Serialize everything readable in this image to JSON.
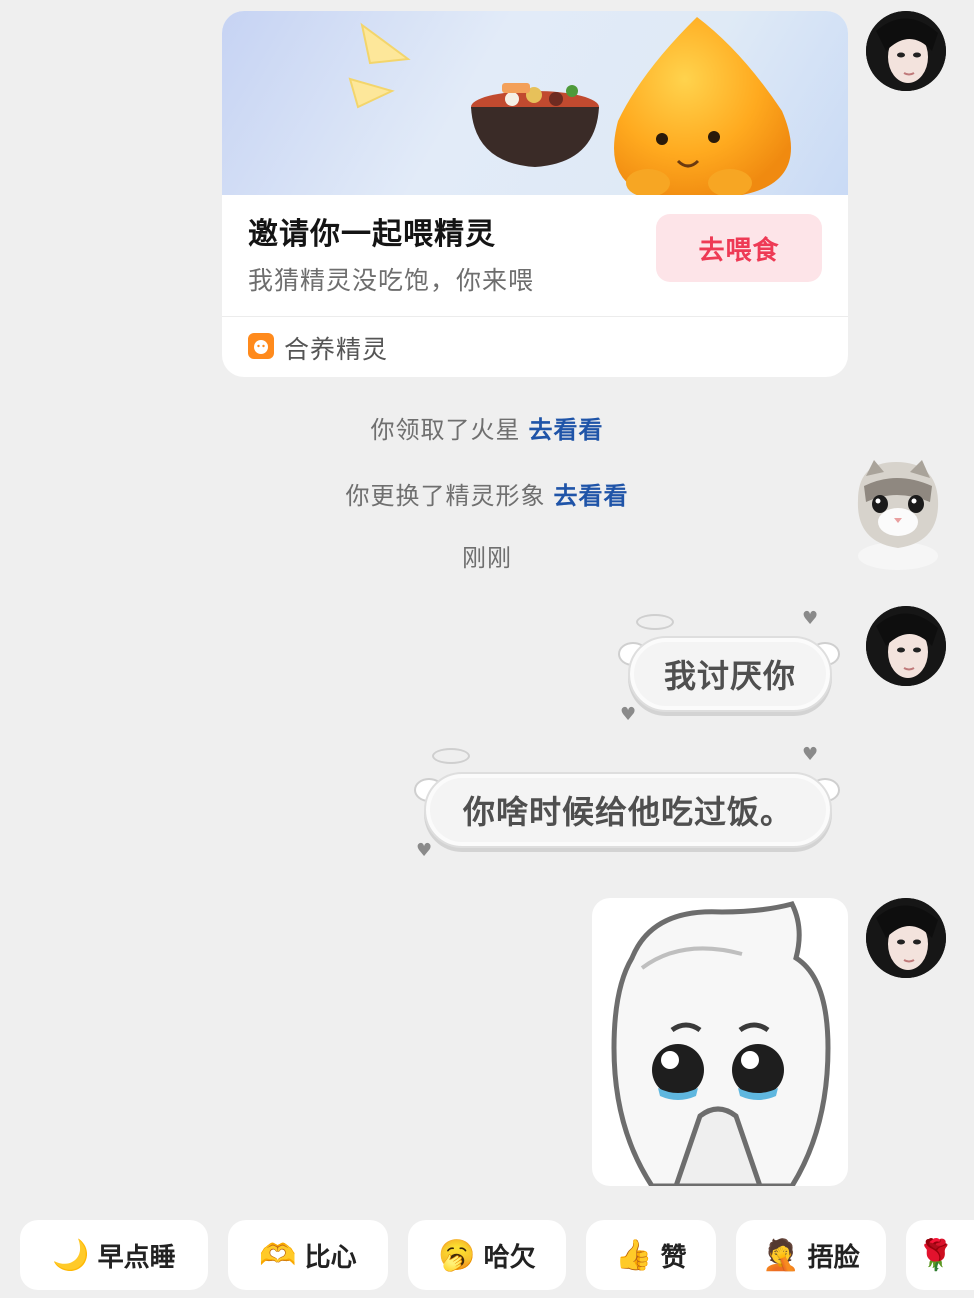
{
  "invite_card": {
    "title": "邀请你一起喂精灵",
    "subtitle": "我猜精灵没吃饱，你来喂",
    "button_label": "去喂食",
    "app_name": "合养精灵"
  },
  "system_messages": [
    {
      "text": "你领取了火星",
      "link": "去看看"
    },
    {
      "text": "你更换了精灵形象",
      "link": "去看看"
    }
  ],
  "timestamp": "刚刚",
  "messages": [
    {
      "text": "我讨厌你"
    },
    {
      "text": "你啥时候给他吃过饭。"
    }
  ],
  "quick_replies": [
    {
      "label": "早点睡",
      "icon": "sleep-icon",
      "emoji": "🌙"
    },
    {
      "label": "比心",
      "icon": "heart-hands-icon",
      "emoji": "🫶"
    },
    {
      "label": "哈欠",
      "icon": "yawn-icon",
      "emoji": "🥱"
    },
    {
      "label": "赞",
      "icon": "thumbs-up-icon",
      "emoji": "👍"
    },
    {
      "label": "捂脸",
      "icon": "facepalm-icon",
      "emoji": "🤦"
    },
    {
      "label": "",
      "icon": "rose-icon",
      "emoji": "🌹"
    }
  ],
  "colors": {
    "background": "#efefef",
    "feed_button_bg": "#fde4e8",
    "feed_button_text": "#ee3a55",
    "link": "#1f54a8",
    "app_icon": "#ff8a1c"
  }
}
